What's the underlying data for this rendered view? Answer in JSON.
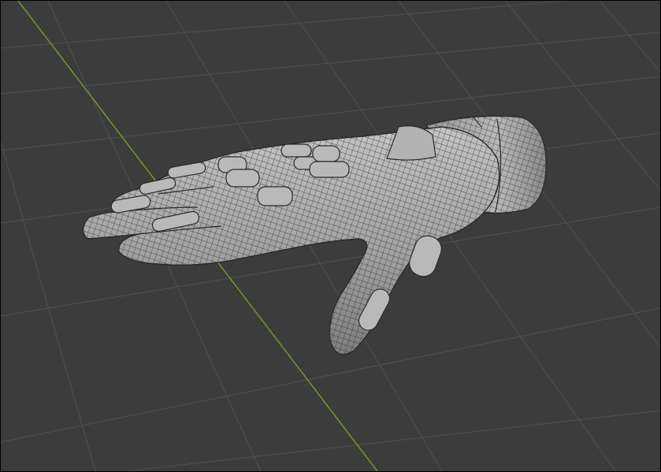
{
  "viewport": {
    "mode": "3d-viewport",
    "background_color": "#3c3c3c",
    "grid_line_color": "#4f4f4f",
    "axis_color": "#6e9a2c",
    "object": {
      "name_icon": "hand-mesh-icon",
      "shading": "solid-wireframe",
      "surface_color": "#a8a8a8",
      "wire_color": "#2a2a2a"
    }
  }
}
